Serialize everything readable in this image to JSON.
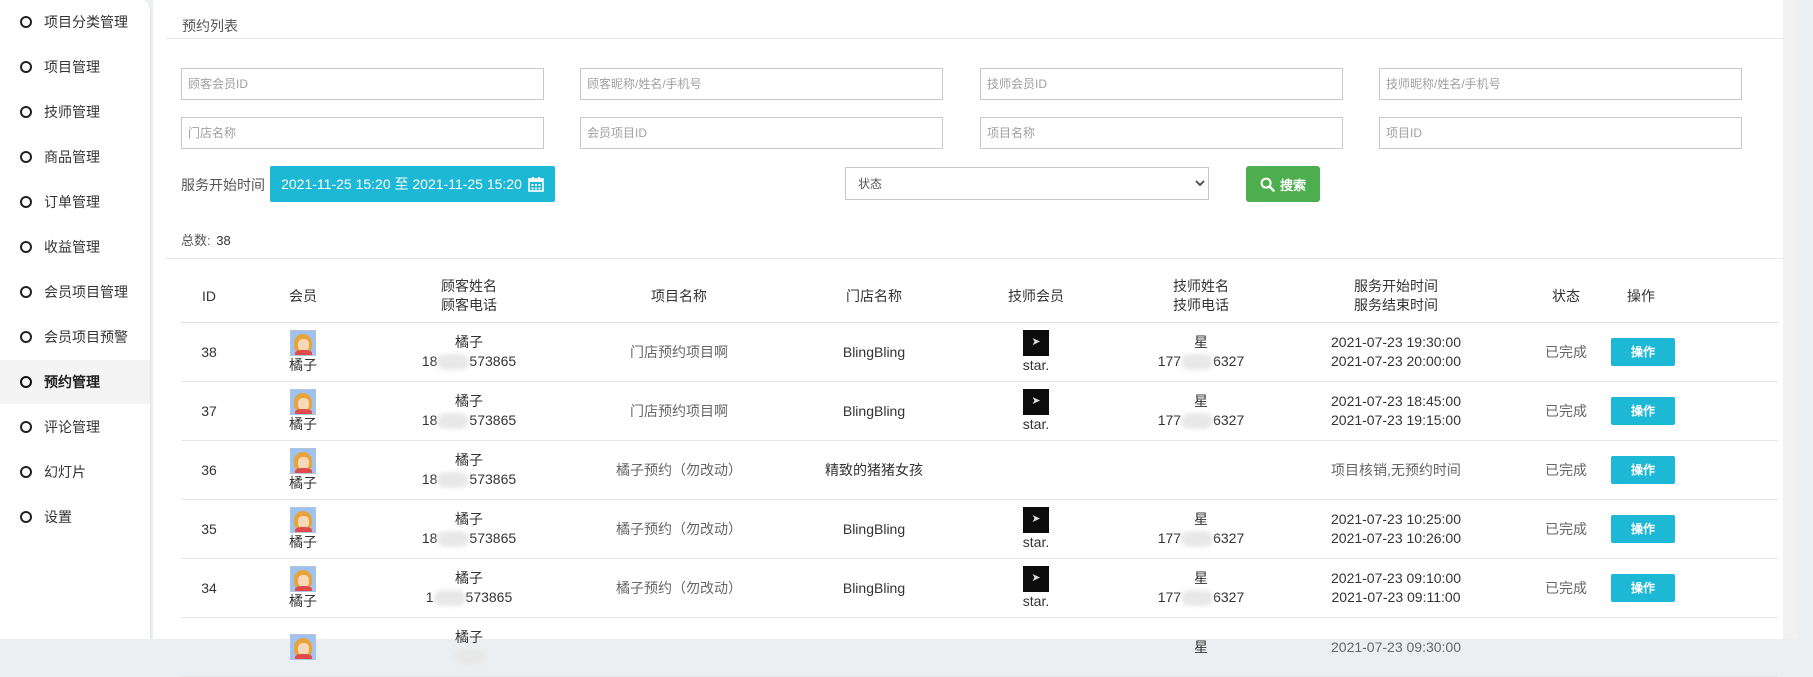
{
  "sidebar": {
    "items": [
      {
        "label": "项目分类管理",
        "active": false
      },
      {
        "label": "项目管理",
        "active": false
      },
      {
        "label": "技师管理",
        "active": false
      },
      {
        "label": "商品管理",
        "active": false
      },
      {
        "label": "订单管理",
        "active": false
      },
      {
        "label": "收益管理",
        "active": false
      },
      {
        "label": "会员项目管理",
        "active": false
      },
      {
        "label": "会员项目预警",
        "active": false
      },
      {
        "label": "预约管理",
        "active": true
      },
      {
        "label": "评论管理",
        "active": false
      },
      {
        "label": "幻灯片",
        "active": false
      },
      {
        "label": "设置",
        "active": false
      }
    ]
  },
  "panel": {
    "title": "预约列表"
  },
  "filters": {
    "customer_id_placeholder": "顾客会员ID",
    "customer_name_placeholder": "顾客昵称/姓名/手机号",
    "tech_id_placeholder": "技师会员ID",
    "tech_name_placeholder": "技师昵称/姓名/手机号",
    "store_placeholder": "门店名称",
    "member_project_id_placeholder": "会员项目ID",
    "project_name_placeholder": "项目名称",
    "project_id_placeholder": "项目ID",
    "service_time_label": "服务开始时间",
    "date_range": "2021-11-25 15:20 至 2021-11-25 15:20",
    "status_placeholder": "状态",
    "search_label": "搜索"
  },
  "total": {
    "label": "总数:",
    "value": "38"
  },
  "table": {
    "headers": {
      "id": "ID",
      "member": "会员",
      "customer_name": "顾客姓名",
      "customer_phone": "顾客电话",
      "project": "项目名称",
      "store": "门店名称",
      "tech_member": "技师会员",
      "tech_name": "技师姓名",
      "tech_phone": "技师电话",
      "start": "服务开始时间",
      "end": "服务结束时间",
      "status": "状态",
      "action": "操作"
    },
    "rows": [
      {
        "id": "38",
        "member": "橘子",
        "customer_name": "橘子",
        "phone_pre": "18",
        "phone_post": "573865",
        "project": "门店预约项目啊",
        "store": "BlingBling",
        "tech": "star.",
        "tech_name": "星",
        "tech_phone_pre": "177",
        "tech_phone_post": "6327",
        "start": "2021-07-23 19:30:00",
        "end": "2021-07-23 20:00:00",
        "status": "已完成",
        "action": "操作"
      },
      {
        "id": "37",
        "member": "橘子",
        "customer_name": "橘子",
        "phone_pre": "18",
        "phone_post": "573865",
        "project": "门店预约项目啊",
        "store": "BlingBling",
        "tech": "star.",
        "tech_name": "星",
        "tech_phone_pre": "177",
        "tech_phone_post": "6327",
        "start": "2021-07-23 18:45:00",
        "end": "2021-07-23 19:15:00",
        "status": "已完成",
        "action": "操作"
      },
      {
        "id": "36",
        "member": "橘子",
        "customer_name": "橘子",
        "phone_pre": "18",
        "phone_post": "573865",
        "project": "橘子预约（勿改动）",
        "store": "精致的猪猪女孩",
        "tech": "",
        "tech_name": "",
        "tech_phone_pre": "",
        "tech_phone_post": "",
        "start": "项目核销,无预约时间",
        "end": "",
        "status": "已完成",
        "action": "操作"
      },
      {
        "id": "35",
        "member": "橘子",
        "customer_name": "橘子",
        "phone_pre": "18",
        "phone_post": "573865",
        "project": "橘子预约（勿改动）",
        "store": "BlingBling",
        "tech": "star.",
        "tech_name": "星",
        "tech_phone_pre": "177",
        "tech_phone_post": "6327",
        "start": "2021-07-23 10:25:00",
        "end": "2021-07-23 10:26:00",
        "status": "已完成",
        "action": "操作"
      },
      {
        "id": "34",
        "member": "橘子",
        "customer_name": "橘子",
        "phone_pre": "1",
        "phone_post": "573865",
        "project": "橘子预约（勿改动）",
        "store": "BlingBling",
        "tech": "star.",
        "tech_name": "星",
        "tech_phone_pre": "177",
        "tech_phone_post": "6327",
        "start": "2021-07-23 09:10:00",
        "end": "2021-07-23 09:11:00",
        "status": "已完成",
        "action": "操作"
      },
      {
        "id": "",
        "member": "",
        "customer_name": "橘子",
        "phone_pre": "",
        "phone_post": "",
        "project": "",
        "store": "",
        "tech": "",
        "tech_name": "星",
        "tech_phone_pre": "",
        "tech_phone_post": "",
        "start": "2021-07-23 09:30:00",
        "end": "",
        "status": "",
        "action": ""
      }
    ]
  },
  "colors": {
    "accent": "#1cb8d6",
    "search": "#4cae4c"
  }
}
